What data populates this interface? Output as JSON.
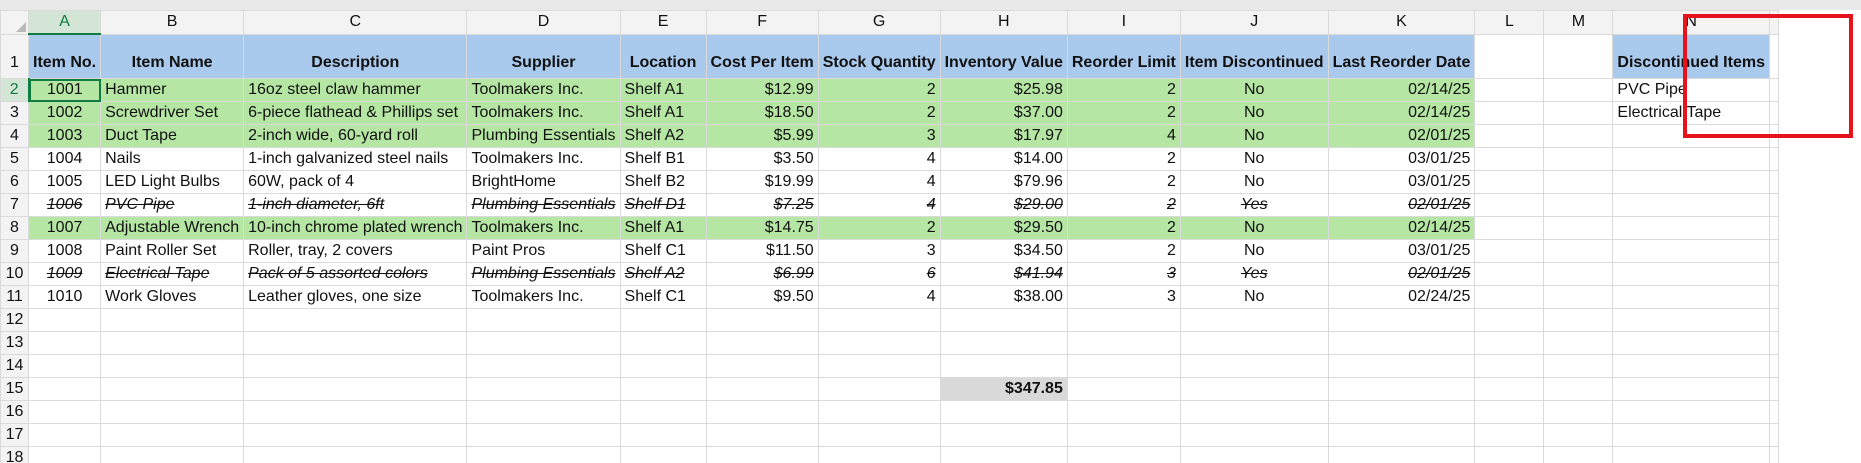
{
  "columns": [
    "A",
    "B",
    "C",
    "D",
    "E",
    "F",
    "G",
    "H",
    "I",
    "J",
    "K",
    "L",
    "M",
    "N"
  ],
  "rows": [
    1,
    2,
    3,
    4,
    5,
    6,
    7,
    8,
    9,
    10,
    11,
    12,
    13,
    14,
    15,
    16,
    17,
    18
  ],
  "headers": [
    "Item No.",
    "Item Name",
    "Description",
    "Supplier",
    "Location",
    "Cost Per Item",
    "Stock Quantity",
    "Inventory Value",
    "Reorder Limit",
    "Item Discontinued",
    "Last Reorder Date"
  ],
  "items": [
    [
      "1001",
      "Hammer",
      "16oz steel claw hammer",
      "Toolmakers Inc.",
      "Shelf A1",
      "$12.99",
      "2",
      "$25.98",
      "2",
      "No",
      "02/14/25"
    ],
    [
      "1002",
      "Screwdriver Set",
      "6-piece flathead & Phillips set",
      "Toolmakers Inc.",
      "Shelf A1",
      "$18.50",
      "2",
      "$37.00",
      "2",
      "No",
      "02/14/25"
    ],
    [
      "1003",
      "Duct Tape",
      "2-inch wide, 60-yard roll",
      "Plumbing Essentials",
      "Shelf A2",
      "$5.99",
      "3",
      "$17.97",
      "4",
      "No",
      "02/01/25"
    ],
    [
      "1004",
      "Nails",
      "1-inch galvanized steel nails",
      "Toolmakers Inc.",
      "Shelf B1",
      "$3.50",
      "4",
      "$14.00",
      "2",
      "No",
      "03/01/25"
    ],
    [
      "1005",
      "LED Light Bulbs",
      "60W, pack of 4",
      "BrightHome",
      "Shelf B2",
      "$19.99",
      "4",
      "$79.96",
      "2",
      "No",
      "03/01/25"
    ],
    [
      "1006",
      "PVC Pipe",
      "1-inch diameter, 6ft",
      "Plumbing Essentials",
      "Shelf D1",
      "$7.25",
      "4",
      "$29.00",
      "2",
      "Yes",
      "02/01/25"
    ],
    [
      "1007",
      "Adjustable Wrench",
      "10-inch chrome plated wrench",
      "Toolmakers Inc.",
      "Shelf A1",
      "$14.75",
      "2",
      "$29.50",
      "2",
      "No",
      "02/14/25"
    ],
    [
      "1008",
      "Paint Roller Set",
      "Roller, tray, 2 covers",
      "Paint Pros",
      "Shelf C1",
      "$11.50",
      "3",
      "$34.50",
      "2",
      "No",
      "03/01/25"
    ],
    [
      "1009",
      "Electrical Tape",
      "Pack of 5 assorted colors",
      "Plumbing Essentials",
      "Shelf A2",
      "$6.99",
      "6",
      "$41.94",
      "3",
      "Yes",
      "02/01/25"
    ],
    [
      "1010",
      "Work Gloves",
      "Leather gloves, one size",
      "Toolmakers Inc.",
      "Shelf C1",
      "$9.50",
      "4",
      "$38.00",
      "3",
      "No",
      "02/24/25"
    ]
  ],
  "total_inventory_value": "$347.85",
  "discontinued": {
    "header": "Discontinued Items",
    "items": [
      "PVC Pipe",
      "Electrical Tape"
    ]
  },
  "colors": {
    "header_fill": "#a9c9ed",
    "low_stock_fill": "#b5e6a3",
    "total_fill": "#d9d9d9",
    "highlight_border": "#e8121c",
    "selection": "#107c41"
  }
}
